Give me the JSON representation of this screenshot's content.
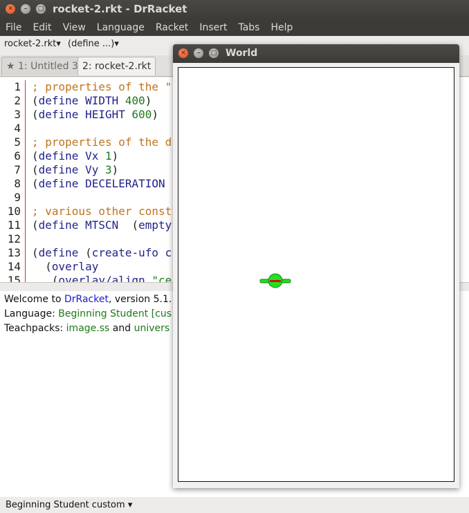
{
  "window": {
    "title": "rocket-2.rkt - DrRacket"
  },
  "menubar": [
    "File",
    "Edit",
    "View",
    "Language",
    "Racket",
    "Insert",
    "Tabs",
    "Help"
  ],
  "toolbar": {
    "file_dropdown": "rocket-2.rkt",
    "define_dropdown": "(define ...)"
  },
  "tabs": [
    {
      "label": "1: Untitled 3",
      "starred": true,
      "star": "★"
    },
    {
      "label": "2: rocket-2.rkt",
      "starred": false
    }
  ],
  "editor": {
    "line_numbers": [
      "1",
      "2",
      "3",
      "4",
      "5",
      "6",
      "7",
      "8",
      "9",
      "10",
      "11",
      "12",
      "13",
      "14",
      "15"
    ],
    "lines": [
      "; properties of the \"",
      "(define WIDTH 400)",
      "(define HEIGHT 600)",
      "",
      "; properties of the d",
      "(define Vx 1)",
      "(define Vy 3)",
      "(define DECELERATION",
      "",
      "; various other const",
      "(define MTSCN  (empty",
      "",
      "(define (create-ufo c",
      "  (overlay",
      "   (overlay/align \"ce"
    ]
  },
  "interactions": {
    "welcome_prefix": "Welcome to ",
    "welcome_link": "DrRacket",
    "welcome_suffix": ", version 5.1.",
    "language_prefix": "Language: ",
    "language_value": "Beginning Student [cus",
    "teachpacks_prefix": "Teachpacks: ",
    "teachpack_1": "image.ss",
    "teachpacks_and": " and ",
    "teachpack_2": "univers"
  },
  "statusbar": {
    "language": "Beginning Student custom"
  },
  "world_window": {
    "title": "World"
  },
  "colors": {
    "ufo_body": "#22e022",
    "ufo_lights": "#d01010"
  }
}
